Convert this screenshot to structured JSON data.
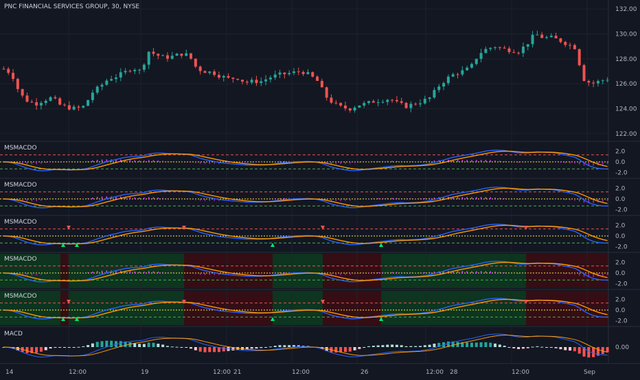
{
  "header": {
    "symbol_title": "PNC FINANCIAL SERVICES GROUP, 30, NYSE"
  },
  "price_axis": {
    "ticks": [
      "132.00",
      "130.00",
      "128.00",
      "126.00",
      "124.00",
      "122.00"
    ],
    "values": [
      132,
      130,
      128,
      126,
      124,
      122
    ]
  },
  "indicator_panes": [
    {
      "label": "MSMACDO",
      "ticks": [
        "2.0",
        "0.0",
        "-2.0"
      ],
      "triangles": false,
      "bg": false
    },
    {
      "label": "MSMACDO",
      "ticks": [
        "2.0",
        "0.0",
        "-2.0"
      ],
      "triangles": false,
      "bg": false
    },
    {
      "label": "MSMACDO",
      "ticks": [
        "2.0",
        "0.0",
        "-2.0"
      ],
      "triangles": true,
      "bg": false
    },
    {
      "label": "MSMACDO",
      "ticks": [
        "2.0",
        "0.0",
        "-2.0"
      ],
      "triangles": false,
      "bg": true
    },
    {
      "label": "MSMACDO",
      "ticks": [
        "2.0",
        "0.0",
        "-2.0"
      ],
      "triangles": true,
      "bg": true
    }
  ],
  "macd_pane": {
    "label": "MACD",
    "tick": "0.00"
  },
  "time_axis": {
    "labels": [
      "14",
      "12:00",
      "19",
      "12:00",
      "21",
      "12:00",
      "26",
      "12:00",
      "28",
      "12:00",
      "Sep"
    ]
  },
  "colors": {
    "background": "#131722",
    "up": "#26a69a",
    "down": "#ef5350",
    "fast_line": "#2962ff",
    "slow_line": "#ff9800",
    "hist_pos": "#e040fb",
    "hist_neg": "#9c27b0",
    "bull_bg": "#0d3b1e",
    "bear_bg": "#3b0d12"
  },
  "chart_data": {
    "type": "candlestick",
    "price_range": [
      121.5,
      132.5
    ],
    "close_path": [
      127.2,
      126.8,
      125.2,
      124.6,
      124.4,
      124.7,
      124.9,
      124.3,
      124.1,
      124.0,
      124.2,
      125.3,
      125.8,
      126.4,
      126.6,
      126.9,
      127.3,
      127.0,
      128.6,
      128.3,
      128.1,
      128.2,
      128.4,
      128.3,
      127.2,
      127.0,
      126.9,
      126.6,
      126.4,
      126.5,
      126.1,
      126.2,
      126.2,
      126.5,
      126.7,
      126.8,
      126.9,
      127.0,
      126.7,
      126.2,
      125.0,
      124.4,
      124.1,
      124.0,
      124.3,
      124.4,
      124.6,
      124.7,
      124.8,
      124.4,
      124.2,
      124.4,
      124.6,
      124.9,
      125.8,
      126.4,
      126.8,
      127.0,
      127.3,
      128.4,
      128.8,
      129.0,
      128.8,
      128.7,
      128.6,
      129.2,
      130.0,
      129.7,
      129.7,
      129.5,
      129.2,
      128.9,
      126.4,
      126.0,
      126.2,
      126.4
    ]
  }
}
